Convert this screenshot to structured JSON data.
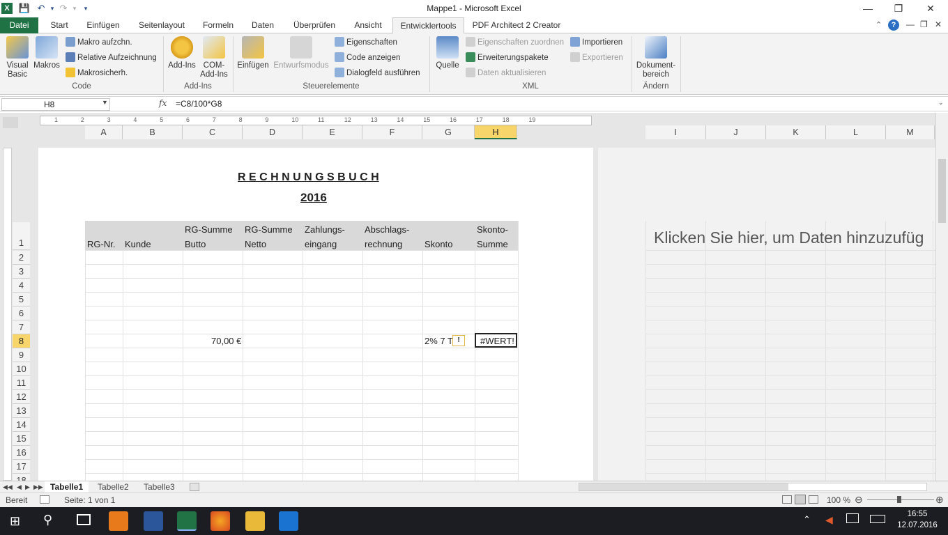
{
  "window": {
    "title": "Mappe1 - Microsoft Excel"
  },
  "tabs": [
    "Datei",
    "Start",
    "Einfügen",
    "Seitenlayout",
    "Formeln",
    "Daten",
    "Überprüfen",
    "Ansicht",
    "Entwicklertools",
    "PDF Architect 2 Creator"
  ],
  "ribbon": {
    "visual_basic": "Visual Basic",
    "makros": "Makros",
    "makro_aufzeichnen": "Makro aufzchn.",
    "relative_aufzeichnung": "Relative Aufzeichnung",
    "makrosicherheit": "Makrosicherh.",
    "group_code": "Code",
    "add_ins": "Add-Ins",
    "com_add_ins": "COM-Add-Ins",
    "group_add_ins": "Add-Ins",
    "einfuegen": "Einfügen",
    "entwurfsmodus": "Entwurfsmodus",
    "eigenschaften": "Eigenschaften",
    "code_anzeigen": "Code anzeigen",
    "dialogfeld": "Dialogfeld ausführen",
    "group_steuerelemente": "Steuerelemente",
    "quelle": "Quelle",
    "eig_zuordnen": "Eigenschaften zuordnen",
    "erweiterungspakete": "Erweiterungspakete",
    "daten_aktualisieren": "Daten aktualisieren",
    "importieren": "Importieren",
    "exportieren": "Exportieren",
    "group_xml": "XML",
    "dokumentbereich": "Dokument-bereich",
    "group_aendern": "Ändern"
  },
  "formula_bar": {
    "name_box": "H8",
    "fx": "fx",
    "formula": "=C8/100*G8"
  },
  "ruler_numbers": [
    "1",
    "2",
    "3",
    "4",
    "5",
    "6",
    "7",
    "8",
    "9",
    "10",
    "11",
    "12",
    "13",
    "14",
    "15",
    "16",
    "17",
    "18",
    "19"
  ],
  "columns": [
    "A",
    "B",
    "C",
    "D",
    "E",
    "F",
    "G",
    "H",
    "I",
    "J",
    "K",
    "L",
    "M"
  ],
  "rows": [
    "1",
    "2",
    "3",
    "4",
    "5",
    "6",
    "7",
    "8",
    "9",
    "10",
    "11",
    "12",
    "13",
    "14",
    "15",
    "16",
    "17",
    "18"
  ],
  "sheet": {
    "title": "R E C H N U N G S B U C H",
    "year": "2016",
    "headers": [
      {
        "l1": "",
        "l2": "RG-Nr."
      },
      {
        "l1": "",
        "l2": "Kunde"
      },
      {
        "l1": "RG-Summe",
        "l2": "Butto"
      },
      {
        "l1": "RG-Summe",
        "l2": "Netto"
      },
      {
        "l1": "Zahlungs-",
        "l2": "eingang"
      },
      {
        "l1": "Abschlags-",
        "l2": "rechnung"
      },
      {
        "l1": "",
        "l2": "Skonto"
      },
      {
        "l1": "Skonto-",
        "l2": "Summe"
      }
    ],
    "c8": "70,00 €",
    "g8": "2% 7 T",
    "h8": "#WERT!",
    "placeholder": "Klicken Sie hier, um Daten hinzuzufüg"
  },
  "sheet_tabs": [
    "Tabelle1",
    "Tabelle2",
    "Tabelle3"
  ],
  "status": {
    "ready": "Bereit",
    "page": "Seite: 1 von 1",
    "zoom": "100 %"
  },
  "taskbar": {
    "time": "16:55",
    "date": "12.07.2016"
  }
}
